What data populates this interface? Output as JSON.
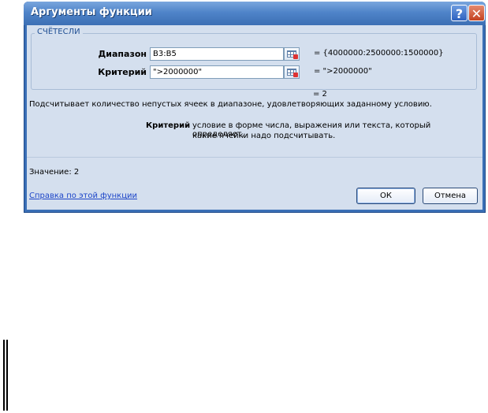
{
  "window": {
    "title": "Аргументы функции"
  },
  "title_buttons": {
    "help": "?",
    "close": "✕"
  },
  "function_group": {
    "name": "СЧЁТЕСЛИ"
  },
  "arguments": [
    {
      "label": "Диапазон",
      "value": "B3:B5",
      "result": "=  {4000000:2500000:1500000}"
    },
    {
      "label": "Критерий",
      "value": "\">2000000\"",
      "result": "=  \">2000000\""
    }
  ],
  "formula_result": "=  2",
  "description": "Подсчитывает количество непустых ячеек в диапазоне, удовлетворяющих заданному условию.",
  "argument_help": {
    "name": "Критерий",
    "text_line1": "условие в форме числа, выражения или текста, который определяет,",
    "text_line2": "какие ячейки надо подсчитывать."
  },
  "value_line": "Значение:  2",
  "help_link": "Справка по этой функции",
  "buttons": {
    "ok": "ОК",
    "cancel": "Отмена"
  },
  "icons": [
    "question-icon",
    "close-icon",
    "range-select-icon"
  ]
}
